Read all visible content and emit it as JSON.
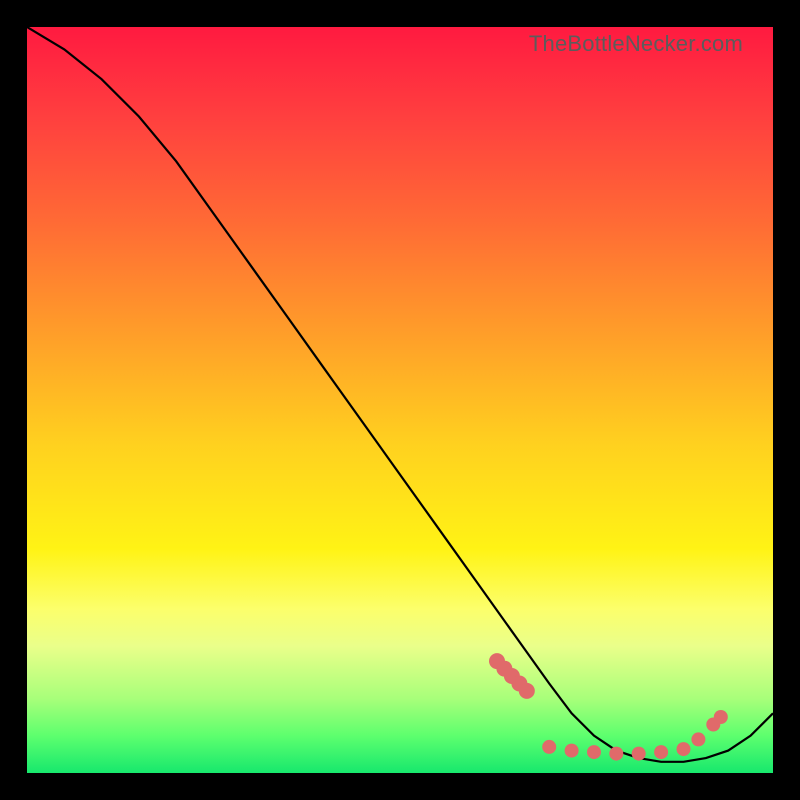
{
  "watermark": "TheBottleNecker.com",
  "colors": {
    "dot": "#e06a6a",
    "curve": "#000000",
    "frame_bg": "#000000"
  },
  "chart_data": {
    "type": "line",
    "title": "",
    "xlabel": "",
    "ylabel": "",
    "note": "Axes have no visible tick labels; x normalized 0–100, y normalized 0–100 (estimated from curve shape).",
    "xlim": [
      0,
      100
    ],
    "ylim": [
      0,
      100
    ],
    "series": [
      {
        "name": "bottleneck-curve",
        "x": [
          0,
          5,
          10,
          15,
          20,
          25,
          30,
          35,
          40,
          45,
          50,
          55,
          60,
          65,
          70,
          73,
          76,
          79,
          82,
          85,
          88,
          91,
          94,
          97,
          100
        ],
        "y": [
          100,
          97,
          93,
          88,
          82,
          75,
          68,
          61,
          54,
          47,
          40,
          33,
          26,
          19,
          12,
          8,
          5,
          3,
          2,
          1.5,
          1.5,
          2,
          3,
          5,
          8
        ]
      }
    ],
    "markers": [
      {
        "name": "cluster-dots",
        "x": 63,
        "y": 15
      },
      {
        "name": "cluster-dots",
        "x": 64,
        "y": 14
      },
      {
        "name": "cluster-dots",
        "x": 65,
        "y": 13
      },
      {
        "name": "cluster-dots",
        "x": 66,
        "y": 12
      },
      {
        "name": "cluster-dots",
        "x": 67,
        "y": 11
      },
      {
        "name": "cluster-dots",
        "x": 70,
        "y": 3.5
      },
      {
        "name": "cluster-dots",
        "x": 73,
        "y": 3
      },
      {
        "name": "cluster-dots",
        "x": 76,
        "y": 2.8
      },
      {
        "name": "cluster-dots",
        "x": 79,
        "y": 2.6
      },
      {
        "name": "cluster-dots",
        "x": 82,
        "y": 2.6
      },
      {
        "name": "cluster-dots",
        "x": 85,
        "y": 2.8
      },
      {
        "name": "cluster-dots",
        "x": 88,
        "y": 3.2
      },
      {
        "name": "cluster-dots",
        "x": 90,
        "y": 4.5
      },
      {
        "name": "cluster-dots",
        "x": 92,
        "y": 6.5
      },
      {
        "name": "cluster-dots",
        "x": 93,
        "y": 7.5
      }
    ]
  }
}
